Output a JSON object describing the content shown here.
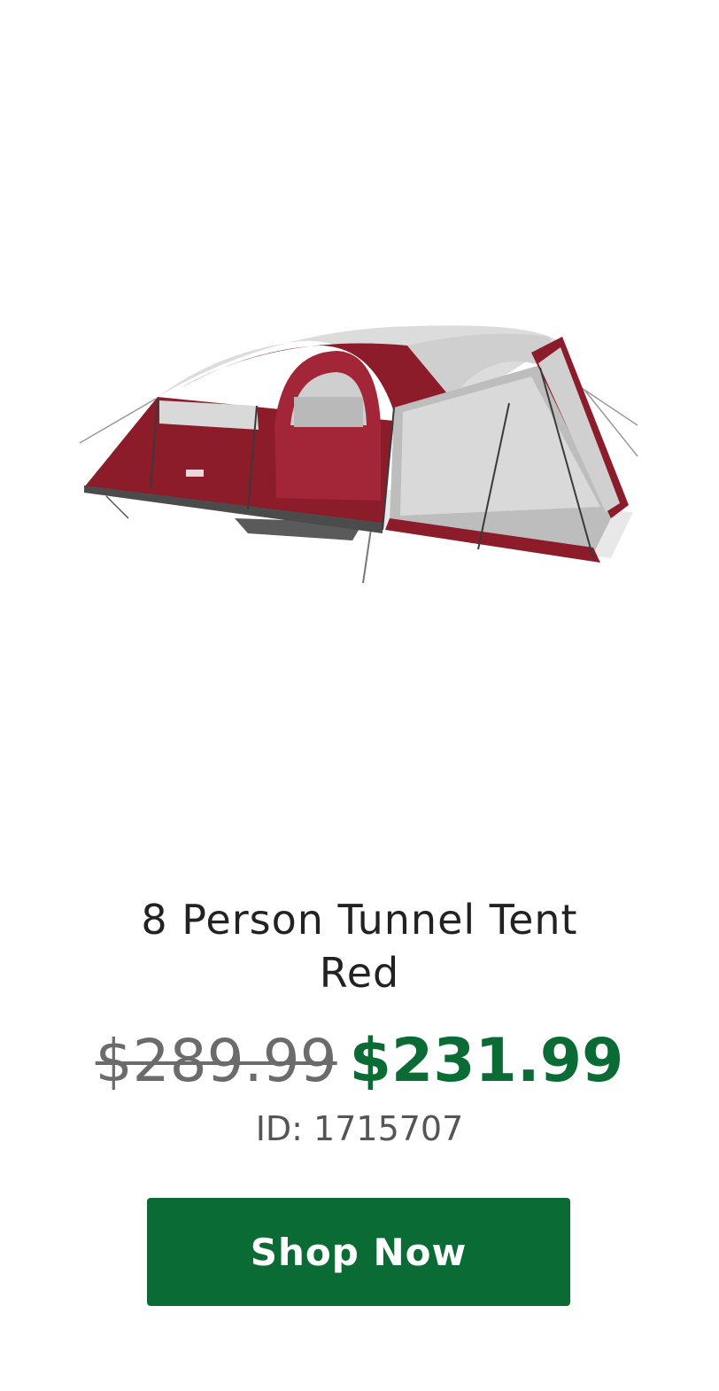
{
  "product": {
    "image_alt": "8 Person Tunnel Tent Red",
    "title_line1": "8 Person Tunnel Tent",
    "title_line2": "Red",
    "original_price": "$289.99",
    "sale_price": "$231.99",
    "id_text": "ID: 1715707",
    "cta_label": "Shop Now"
  },
  "colors": {
    "sale_green": "#0b6b35",
    "tent_red": "#8c1c2a",
    "tent_gray": "#d4d4d4"
  }
}
